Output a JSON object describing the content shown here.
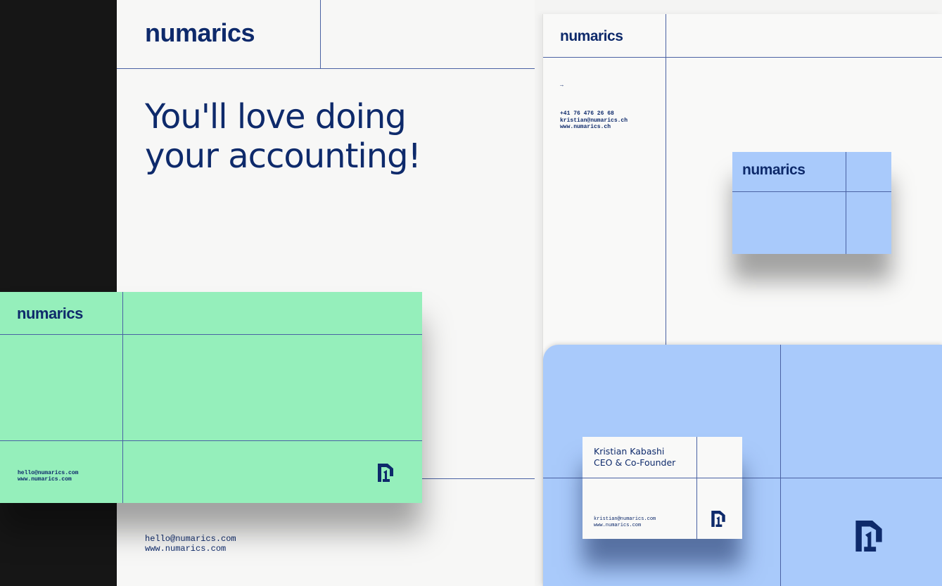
{
  "brand": {
    "logo_text": "numarics",
    "colors": {
      "navy": "#0e2a6b",
      "mint": "#95efbb",
      "light_blue": "#a9cafb",
      "paper": "#f7f7f6",
      "dark": "#161616"
    },
    "mark_icon": "numarics-n1-mark-icon"
  },
  "letter_left": {
    "headline_line1": "You'll love doing",
    "headline_line2": "your accounting!",
    "email": "hello@numarics.com",
    "web": "www.numarics.com"
  },
  "green_card": {
    "email": "hello@numarics.com",
    "web": "www.numarics.com"
  },
  "letter_right": {
    "arrow": "→",
    "phone": "+41 76 476 26 68",
    "email": "kristian@numarics.ch",
    "web": "www.numarics.ch"
  },
  "business_card": {
    "name": "Kristian Kabashi",
    "title": "CEO & Co-Founder",
    "email": "kristian@numarics.com",
    "web": "www.numarics.com"
  }
}
